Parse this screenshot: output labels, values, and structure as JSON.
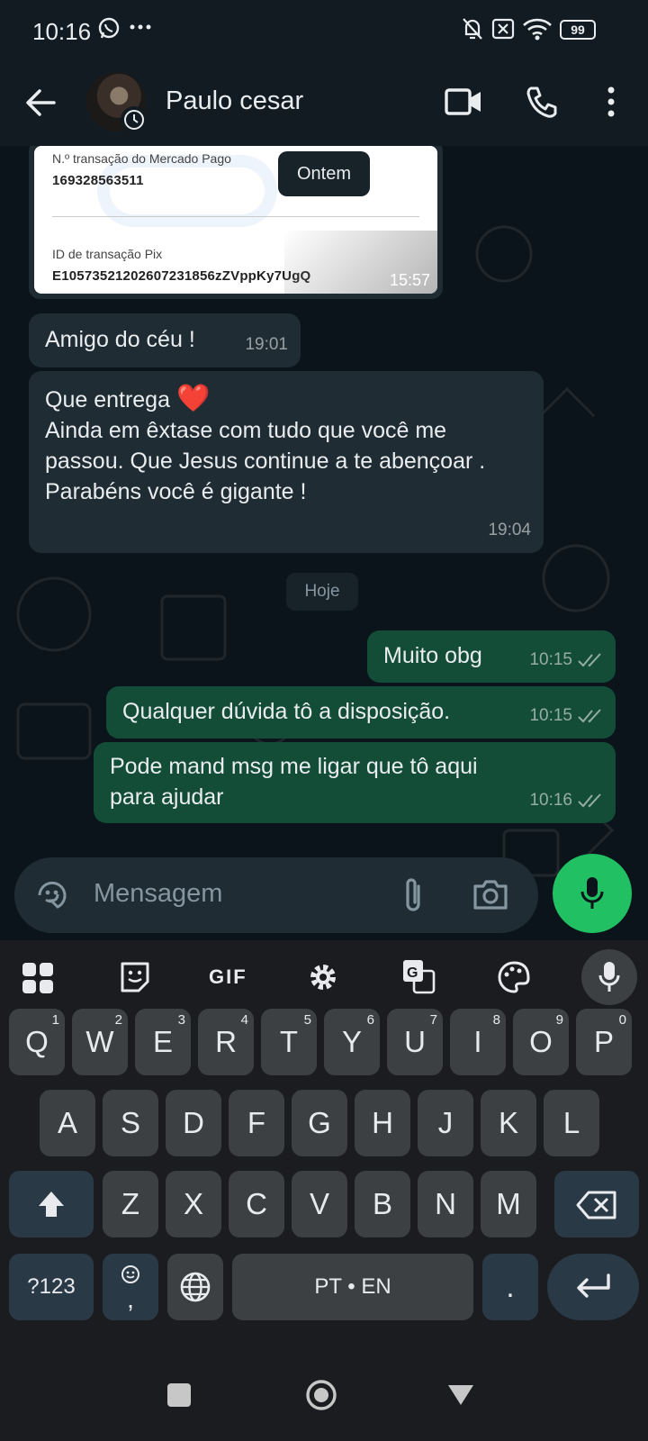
{
  "status_bar": {
    "time": "10:16",
    "battery": "99",
    "icons": [
      "whatsapp-icon",
      "more-dots-icon",
      "mute-icon",
      "sim-x-icon",
      "wifi-icon",
      "battery-icon"
    ]
  },
  "header": {
    "contact_name": "Paulo cesar",
    "icons": [
      "back-arrow-icon",
      "video-call-icon",
      "phone-call-icon",
      "overflow-menu-icon"
    ]
  },
  "chat": {
    "image_message": {
      "label1": "N.º transação do Mercado Pago",
      "value1": "169328563511",
      "label2": "ID de transação Pix",
      "value2": "E10573521202607231856zZVppKy7UgQ",
      "time": "15:57"
    },
    "date_yesterday": "Ontem",
    "date_today": "Hoje",
    "messages": [
      {
        "dir": "in",
        "text": "Amigo do céu !",
        "time": "19:01"
      },
      {
        "dir": "in",
        "line1": "Que entrega",
        "emoji": "❤️",
        "text": "Ainda em êxtase com tudo que você me passou. Que Jesus continue a te abençoar . Parabéns você é gigante !",
        "time": "19:04"
      },
      {
        "dir": "out",
        "text": "Muito obg",
        "time": "10:15"
      },
      {
        "dir": "out",
        "text": "Qualquer dúvida tô a disposição.",
        "time": "10:15"
      },
      {
        "dir": "out",
        "text": "Pode mand msg me ligar que tô aqui para ajudar",
        "time": "10:16"
      }
    ]
  },
  "input": {
    "placeholder": "Mensagem",
    "icons": [
      "sticker-icon",
      "attach-icon",
      "camera-icon",
      "mic-icon"
    ]
  },
  "keyboard": {
    "toolbar": [
      "apps-grid-icon",
      "sticker-icon",
      "gif-icon",
      "settings-icon",
      "translate-icon",
      "palette-icon",
      "voice-icon"
    ],
    "gif_label": "GIF",
    "row1": [
      {
        "k": "Q",
        "h": "1"
      },
      {
        "k": "W",
        "h": "2"
      },
      {
        "k": "E",
        "h": "3"
      },
      {
        "k": "R",
        "h": "4"
      },
      {
        "k": "T",
        "h": "5"
      },
      {
        "k": "Y",
        "h": "6"
      },
      {
        "k": "U",
        "h": "7"
      },
      {
        "k": "I",
        "h": "8"
      },
      {
        "k": "O",
        "h": "9"
      },
      {
        "k": "P",
        "h": "0"
      }
    ],
    "row2": [
      "A",
      "S",
      "D",
      "F",
      "G",
      "H",
      "J",
      "K",
      "L"
    ],
    "row3": [
      "Z",
      "X",
      "C",
      "V",
      "B",
      "N",
      "M"
    ],
    "symbols_key": "?123",
    "comma_key": ",",
    "space_label": "PT • EN",
    "period_key": "."
  },
  "colors": {
    "accent": "#21c063",
    "outgoing": "#144d37",
    "incoming": "#202c33",
    "background": "#0b141a"
  }
}
